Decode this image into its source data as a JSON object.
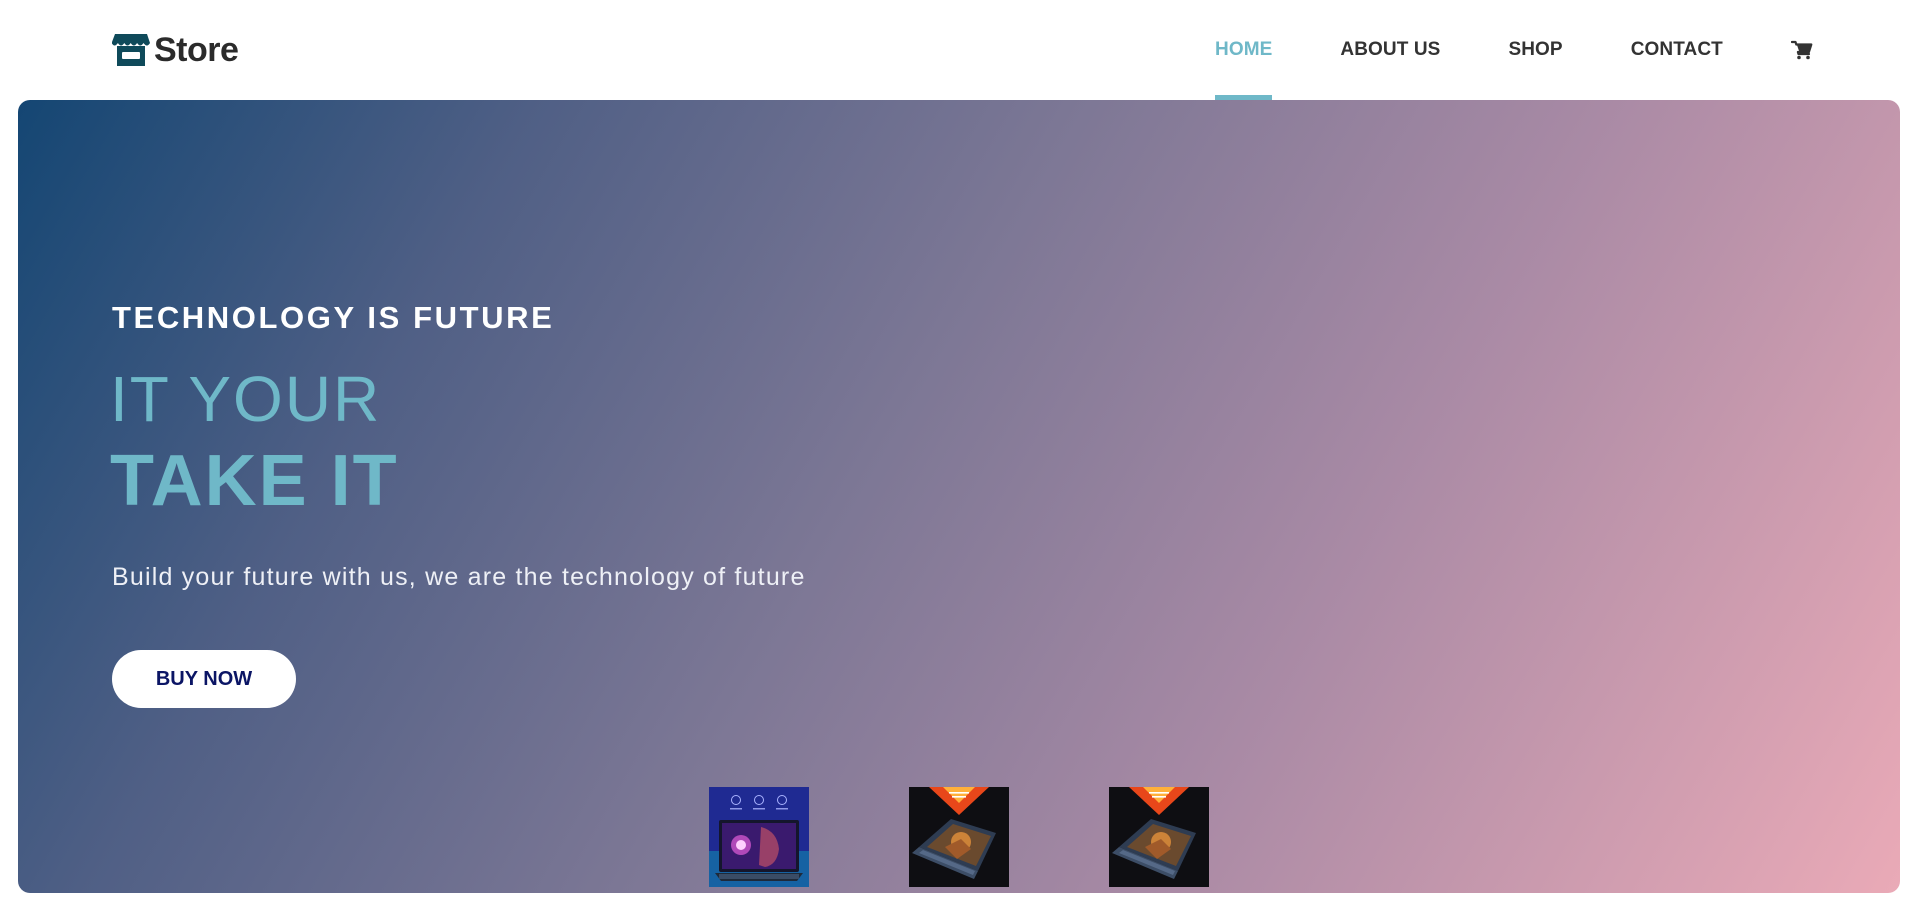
{
  "header": {
    "logo_text": "Store",
    "logo_icon": "storefront-icon",
    "nav": [
      {
        "label": "HOME",
        "active": true
      },
      {
        "label": "ABOUT US",
        "active": false
      },
      {
        "label": "SHOP",
        "active": false
      },
      {
        "label": "CONTACT",
        "active": false
      }
    ],
    "cart_icon": "cart-icon"
  },
  "hero": {
    "tagline": "TECHNOLOGY IS FUTURE",
    "headline_line1": "IT YOUR",
    "headline_line2": "TAKE IT",
    "description": "Build your future with us, we are the technology of future",
    "cta_label": "BUY NOW"
  },
  "thumbnails": [
    {
      "name": "laptop-thumbnail-1",
      "icon": "laptop-image"
    },
    {
      "name": "laptop-thumbnail-2",
      "icon": "laptop-image"
    },
    {
      "name": "laptop-thumbnail-3",
      "icon": "laptop-image"
    }
  ],
  "colors": {
    "accent": "#6fb8c8",
    "cta_text": "#0b1565",
    "logo": "#0f4a5a",
    "nav_text": "#333333"
  }
}
